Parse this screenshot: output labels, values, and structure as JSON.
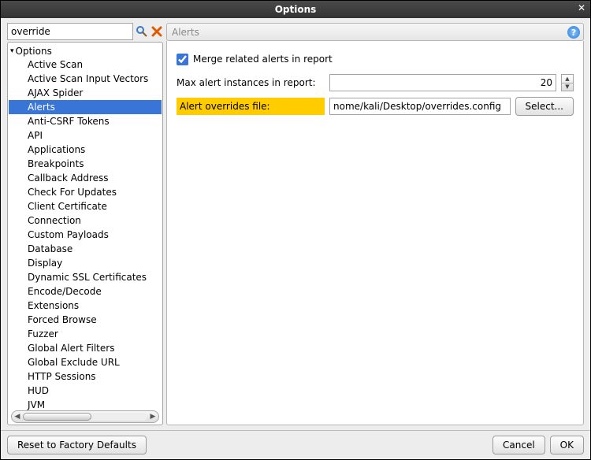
{
  "window": {
    "title": "Options"
  },
  "search": {
    "value": "override"
  },
  "tree": {
    "root_label": "Options",
    "items": [
      "Active Scan",
      "Active Scan Input Vectors",
      "AJAX Spider",
      "Alerts",
      "Anti-CSRF Tokens",
      "API",
      "Applications",
      "Breakpoints",
      "Callback Address",
      "Check For Updates",
      "Client Certificate",
      "Connection",
      "Custom Payloads",
      "Database",
      "Display",
      "Dynamic SSL Certificates",
      "Encode/Decode",
      "Extensions",
      "Forced Browse",
      "Fuzzer",
      "Global Alert Filters",
      "Global Exclude URL",
      "HTTP Sessions",
      "HUD",
      "JVM"
    ],
    "selected_index": 3
  },
  "panel": {
    "title": "Alerts",
    "merge_label": "Merge related alerts in report",
    "merge_checked": true,
    "max_label": "Max alert instances in report:",
    "max_value": "20",
    "overrides_label": "Alert overrides file:",
    "overrides_value": "nome/kali/Desktop/overrides.config",
    "select_label": "Select..."
  },
  "footer": {
    "reset_label": "Reset to Factory Defaults",
    "cancel_label": "Cancel",
    "ok_label": "OK"
  }
}
